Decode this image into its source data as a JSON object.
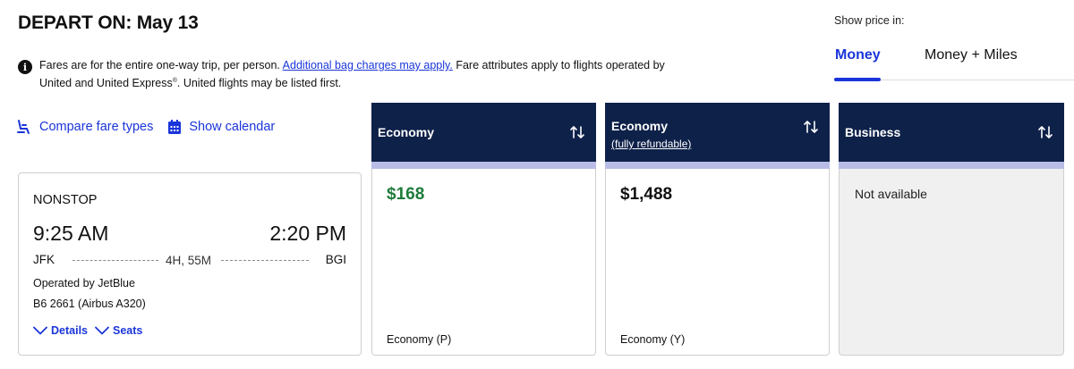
{
  "header": {
    "title": "DEPART ON: May 13",
    "info_prefix": "Fares are for the entire one-way trip, per person. ",
    "info_link": "Additional bag charges may apply.",
    "info_mid": " Fare attributes apply to flights operated by United and United Express",
    "info_sup": "®",
    "info_suffix": ". United flights may be listed first."
  },
  "price_toggle": {
    "label": "Show price in:",
    "tabs": [
      {
        "label": "Money",
        "selected": true
      },
      {
        "label": "Money + Miles",
        "selected": false
      }
    ]
  },
  "actions": {
    "compare": "Compare fare types",
    "calendar": "Show calendar"
  },
  "flight": {
    "stops": "NONSTOP",
    "depart_time": "9:25 AM",
    "arrive_time": "2:20 PM",
    "origin": "JFK",
    "destination": "BGI",
    "duration": "4H, 55M",
    "operated_by": "Operated by JetBlue",
    "flight_number": "B6 2661 (Airbus A320)",
    "details_label": "Details",
    "seats_label": "Seats"
  },
  "fares": [
    {
      "title": "Economy",
      "subtitle": "",
      "price": "$168",
      "fare_class": "Economy (P)",
      "available": true
    },
    {
      "title": "Economy",
      "subtitle": "(fully refundable)",
      "price": "$1,488",
      "fare_class": "Economy (Y)",
      "available": true
    },
    {
      "title": "Business",
      "subtitle": "",
      "price": "",
      "fare_class": "",
      "available": false,
      "unavailable_text": "Not available"
    }
  ],
  "colors": {
    "accent": "#1a35d9",
    "header_navy": "#0e2149",
    "strip": "#b9bde6",
    "price_green": "#1e7c3a"
  }
}
